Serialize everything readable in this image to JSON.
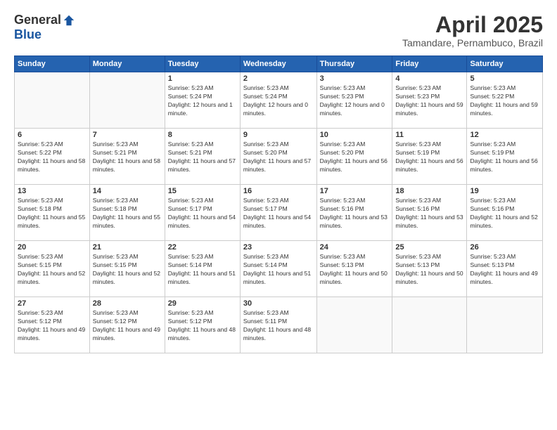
{
  "logo": {
    "general": "General",
    "blue": "Blue"
  },
  "title": "April 2025",
  "subtitle": "Tamandare, Pernambuco, Brazil",
  "weekdays": [
    "Sunday",
    "Monday",
    "Tuesday",
    "Wednesday",
    "Thursday",
    "Friday",
    "Saturday"
  ],
  "weeks": [
    [
      {
        "day": "",
        "info": ""
      },
      {
        "day": "",
        "info": ""
      },
      {
        "day": "1",
        "sunrise": "5:23 AM",
        "sunset": "5:24 PM",
        "daylight": "12 hours and 1 minute."
      },
      {
        "day": "2",
        "sunrise": "5:23 AM",
        "sunset": "5:24 PM",
        "daylight": "12 hours and 0 minutes."
      },
      {
        "day": "3",
        "sunrise": "5:23 AM",
        "sunset": "5:23 PM",
        "daylight": "12 hours and 0 minutes."
      },
      {
        "day": "4",
        "sunrise": "5:23 AM",
        "sunset": "5:23 PM",
        "daylight": "11 hours and 59 minutes."
      },
      {
        "day": "5",
        "sunrise": "5:23 AM",
        "sunset": "5:22 PM",
        "daylight": "11 hours and 59 minutes."
      }
    ],
    [
      {
        "day": "6",
        "sunrise": "5:23 AM",
        "sunset": "5:22 PM",
        "daylight": "11 hours and 58 minutes."
      },
      {
        "day": "7",
        "sunrise": "5:23 AM",
        "sunset": "5:21 PM",
        "daylight": "11 hours and 58 minutes."
      },
      {
        "day": "8",
        "sunrise": "5:23 AM",
        "sunset": "5:21 PM",
        "daylight": "11 hours and 57 minutes."
      },
      {
        "day": "9",
        "sunrise": "5:23 AM",
        "sunset": "5:20 PM",
        "daylight": "11 hours and 57 minutes."
      },
      {
        "day": "10",
        "sunrise": "5:23 AM",
        "sunset": "5:20 PM",
        "daylight": "11 hours and 56 minutes."
      },
      {
        "day": "11",
        "sunrise": "5:23 AM",
        "sunset": "5:19 PM",
        "daylight": "11 hours and 56 minutes."
      },
      {
        "day": "12",
        "sunrise": "5:23 AM",
        "sunset": "5:19 PM",
        "daylight": "11 hours and 56 minutes."
      }
    ],
    [
      {
        "day": "13",
        "sunrise": "5:23 AM",
        "sunset": "5:18 PM",
        "daylight": "11 hours and 55 minutes."
      },
      {
        "day": "14",
        "sunrise": "5:23 AM",
        "sunset": "5:18 PM",
        "daylight": "11 hours and 55 minutes."
      },
      {
        "day": "15",
        "sunrise": "5:23 AM",
        "sunset": "5:17 PM",
        "daylight": "11 hours and 54 minutes."
      },
      {
        "day": "16",
        "sunrise": "5:23 AM",
        "sunset": "5:17 PM",
        "daylight": "11 hours and 54 minutes."
      },
      {
        "day": "17",
        "sunrise": "5:23 AM",
        "sunset": "5:16 PM",
        "daylight": "11 hours and 53 minutes."
      },
      {
        "day": "18",
        "sunrise": "5:23 AM",
        "sunset": "5:16 PM",
        "daylight": "11 hours and 53 minutes."
      },
      {
        "day": "19",
        "sunrise": "5:23 AM",
        "sunset": "5:16 PM",
        "daylight": "11 hours and 52 minutes."
      }
    ],
    [
      {
        "day": "20",
        "sunrise": "5:23 AM",
        "sunset": "5:15 PM",
        "daylight": "11 hours and 52 minutes."
      },
      {
        "day": "21",
        "sunrise": "5:23 AM",
        "sunset": "5:15 PM",
        "daylight": "11 hours and 52 minutes."
      },
      {
        "day": "22",
        "sunrise": "5:23 AM",
        "sunset": "5:14 PM",
        "daylight": "11 hours and 51 minutes."
      },
      {
        "day": "23",
        "sunrise": "5:23 AM",
        "sunset": "5:14 PM",
        "daylight": "11 hours and 51 minutes."
      },
      {
        "day": "24",
        "sunrise": "5:23 AM",
        "sunset": "5:13 PM",
        "daylight": "11 hours and 50 minutes."
      },
      {
        "day": "25",
        "sunrise": "5:23 AM",
        "sunset": "5:13 PM",
        "daylight": "11 hours and 50 minutes."
      },
      {
        "day": "26",
        "sunrise": "5:23 AM",
        "sunset": "5:13 PM",
        "daylight": "11 hours and 49 minutes."
      }
    ],
    [
      {
        "day": "27",
        "sunrise": "5:23 AM",
        "sunset": "5:12 PM",
        "daylight": "11 hours and 49 minutes."
      },
      {
        "day": "28",
        "sunrise": "5:23 AM",
        "sunset": "5:12 PM",
        "daylight": "11 hours and 49 minutes."
      },
      {
        "day": "29",
        "sunrise": "5:23 AM",
        "sunset": "5:12 PM",
        "daylight": "11 hours and 48 minutes."
      },
      {
        "day": "30",
        "sunrise": "5:23 AM",
        "sunset": "5:11 PM",
        "daylight": "11 hours and 48 minutes."
      },
      {
        "day": "",
        "info": ""
      },
      {
        "day": "",
        "info": ""
      },
      {
        "day": "",
        "info": ""
      }
    ]
  ]
}
